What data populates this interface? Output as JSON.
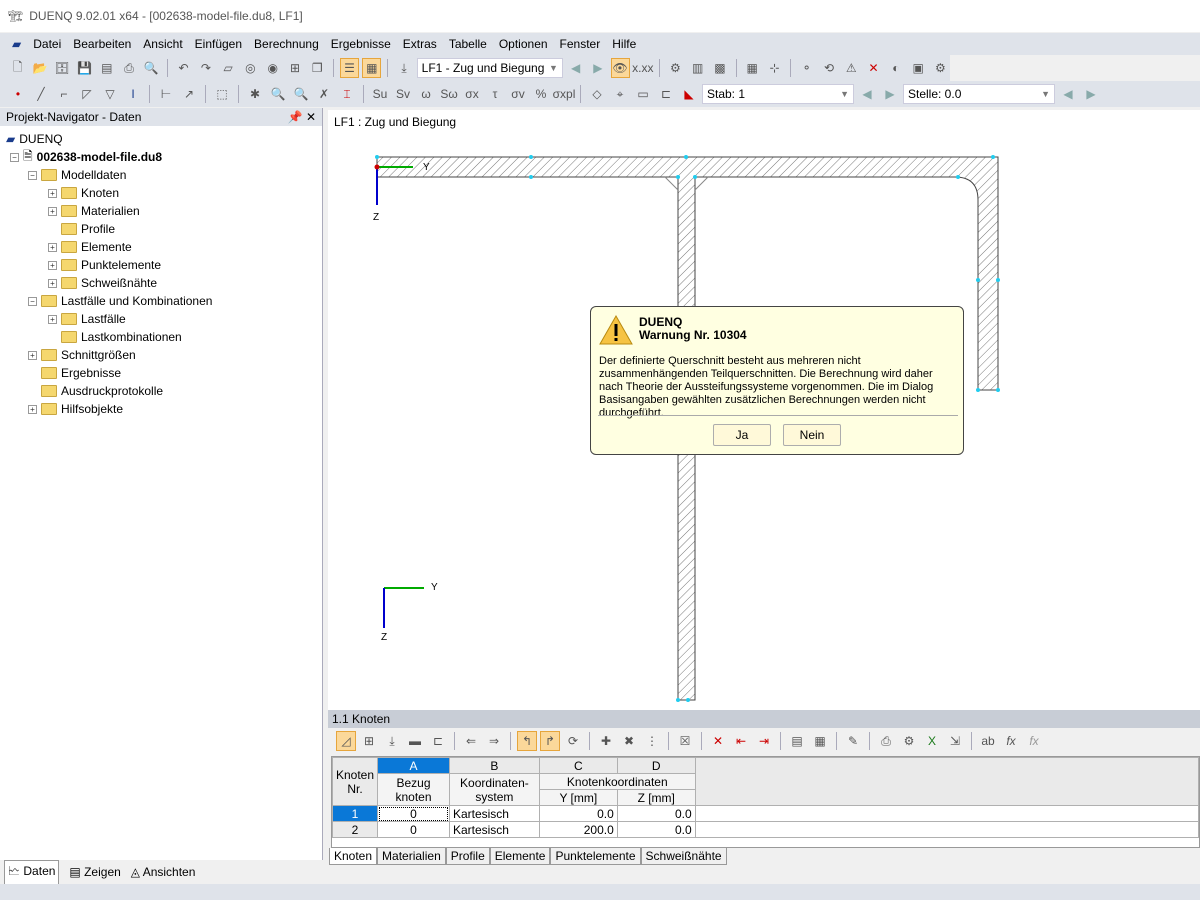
{
  "window": {
    "title": "DUENQ 9.02.01 x64 - [002638-model-file.du8, LF1]"
  },
  "menu": [
    "Datei",
    "Bearbeiten",
    "Ansicht",
    "Einfügen",
    "Berechnung",
    "Ergebnisse",
    "Extras",
    "Tabelle",
    "Optionen",
    "Fenster",
    "Hilfe"
  ],
  "toolbar": {
    "loadcase": "LF1 - Zug und Biegung",
    "stab": "Stab: 1",
    "stelle": "Stelle: 0.0"
  },
  "navigator": {
    "title": "Projekt-Navigator - Daten",
    "root": "DUENQ",
    "file": "002638-model-file.du8",
    "items": [
      {
        "label": "Modelldaten",
        "level": 1
      },
      {
        "label": "Knoten",
        "level": 2
      },
      {
        "label": "Materialien",
        "level": 2
      },
      {
        "label": "Profile",
        "level": 2
      },
      {
        "label": "Elemente",
        "level": 2
      },
      {
        "label": "Punktelemente",
        "level": 2
      },
      {
        "label": "Schweißnähte",
        "level": 2
      },
      {
        "label": "Lastfälle und Kombinationen",
        "level": 1
      },
      {
        "label": "Lastfälle",
        "level": 2
      },
      {
        "label": "Lastkombinationen",
        "level": 2
      },
      {
        "label": "Schnittgrößen",
        "level": 1
      },
      {
        "label": "Ergebnisse",
        "level": 1
      },
      {
        "label": "Ausdruckprotokolle",
        "level": 1
      },
      {
        "label": "Hilfsobjekte",
        "level": 1
      }
    ],
    "tabs": [
      "Daten",
      "Zeigen",
      "Ansichten"
    ]
  },
  "view": {
    "title": "LF1 : Zug und Biegung",
    "axis_y": "Y",
    "axis_z": "Z"
  },
  "dialog": {
    "app": "DUENQ",
    "warning": "Warnung Nr. 10304",
    "message": "Der definierte Querschnitt besteht aus mehreren nicht zusammenhängenden Teilquerschnitten. Die Berechnung wird daher nach Theorie der Aussteifungssysteme vorgenommen. Die im Dialog Basisangaben gewählten zusätzlichen Berechnungen werden nicht durchgeführt.",
    "yes": "Ja",
    "no": "Nein"
  },
  "table": {
    "title": "1.1 Knoten",
    "cols": [
      "A",
      "B",
      "C",
      "D"
    ],
    "h_nr": "Knoten Nr.",
    "h_a": "Bezug knoten",
    "h_b": "Koordinaten-system",
    "h_cd": "Knotenkoordinaten",
    "h_c": "Y [mm]",
    "h_d": "Z [mm]",
    "rows": [
      {
        "nr": "1",
        "a": "0",
        "b": "Kartesisch",
        "c": "0.0",
        "d": "0.0"
      },
      {
        "nr": "2",
        "a": "0",
        "b": "Kartesisch",
        "c": "200.0",
        "d": "0.0"
      }
    ],
    "tabs": [
      "Knoten",
      "Materialien",
      "Profile",
      "Elemente",
      "Punktelemente",
      "Schweißnähte"
    ]
  }
}
